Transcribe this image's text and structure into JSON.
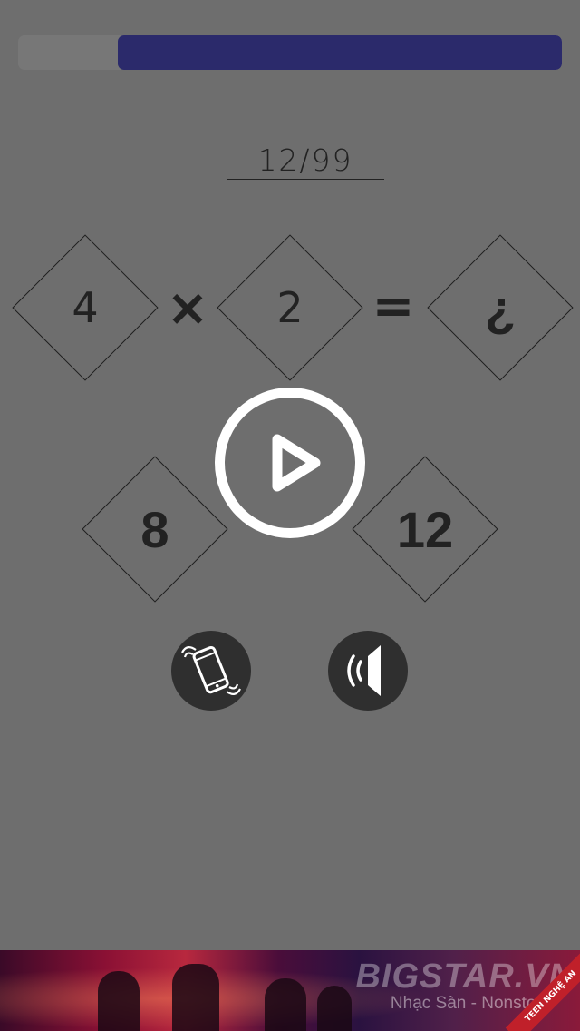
{
  "timer": {
    "remaining_fraction": 0.817,
    "fill_color": "#2b2a6b"
  },
  "progress": {
    "text": "12/99"
  },
  "equation": {
    "operand_a": "4",
    "operator": "×",
    "operand_b": "2",
    "equals": "=",
    "result": "¿"
  },
  "answers": [
    {
      "label": "8"
    },
    {
      "label": "12"
    }
  ],
  "controls": {
    "play_icon": "play-icon",
    "vibrate_icon": "phone-vibrate-icon",
    "sound_icon": "speaker-icon"
  },
  "banner": {
    "brand": "BIGSTAR.VN",
    "tagline": "Nhạc Sàn - Nonstop",
    "ribbon": "TEEN NGHỆ AN"
  }
}
